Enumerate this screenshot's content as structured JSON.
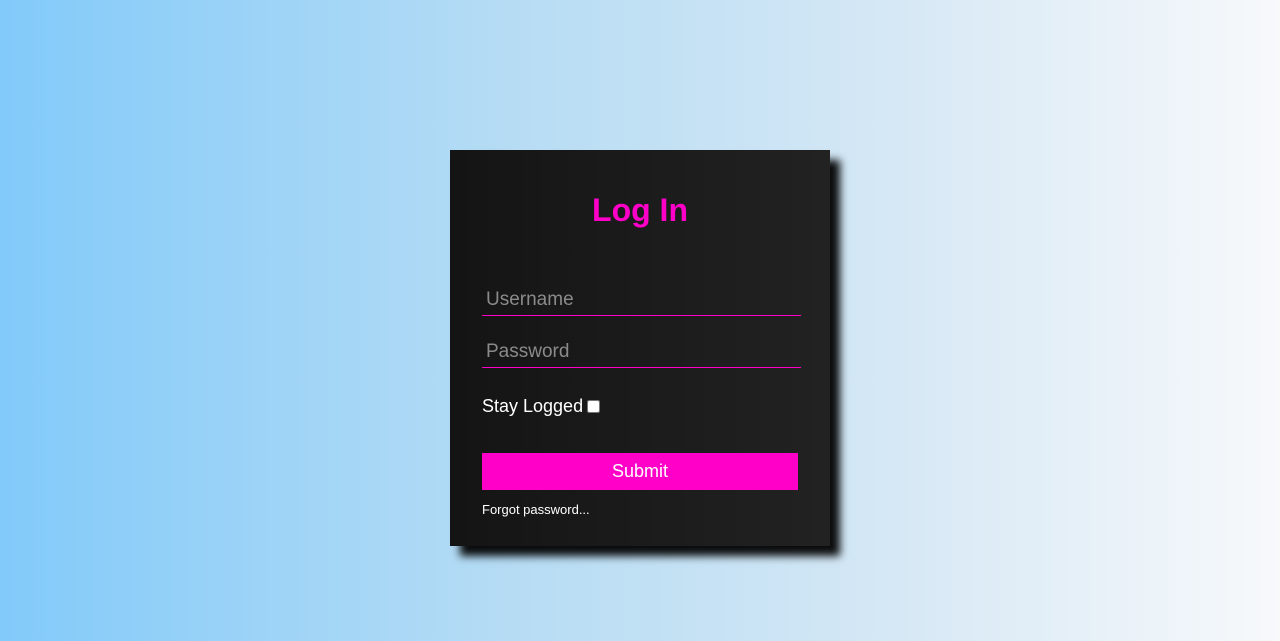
{
  "colors": {
    "accent": "#ff00c8",
    "card_background": "#1b1b1b",
    "text": "#ffffff",
    "placeholder": "#8a8a8a",
    "background_start": "#82cafa",
    "background_end": "#f7f9fb"
  },
  "login": {
    "title": "Log In",
    "username": {
      "value": "",
      "placeholder": "Username"
    },
    "password": {
      "value": "",
      "placeholder": "Password"
    },
    "stay_logged_label": "Stay Logged",
    "stay_logged_checked": false,
    "submit_label": "Submit",
    "forgot_label": "Forgot password..."
  }
}
